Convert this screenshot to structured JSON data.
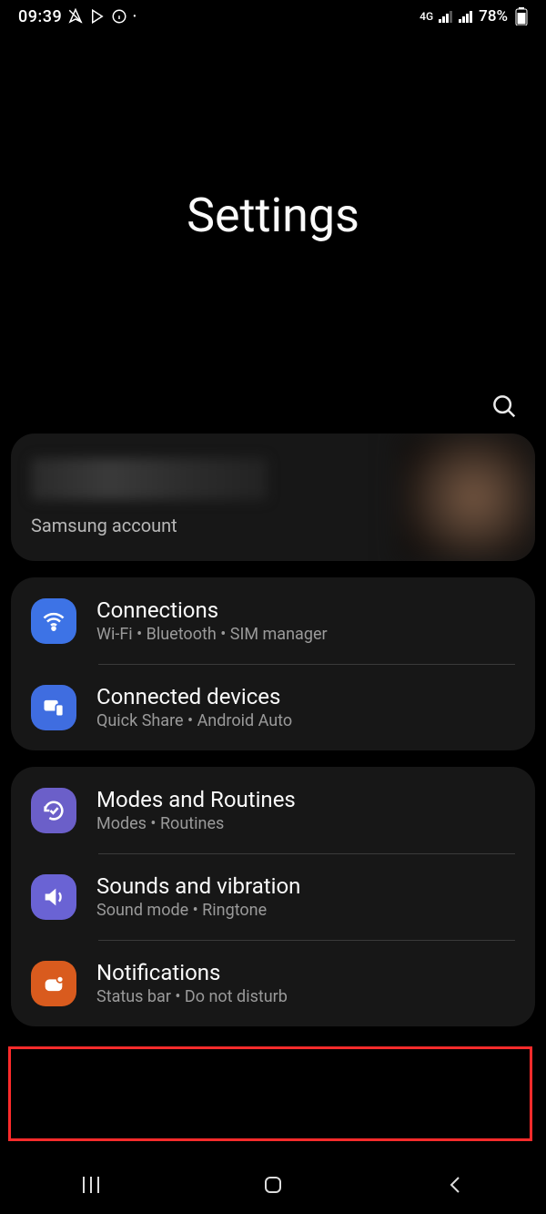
{
  "status_bar": {
    "time": "09:39",
    "network_label": "4G",
    "battery_text": "78%"
  },
  "header": {
    "title": "Settings"
  },
  "account": {
    "label": "Samsung account"
  },
  "groups": [
    {
      "rows": [
        {
          "title": "Connections",
          "subtitle": "Wi-Fi  •  Bluetooth  •  SIM manager"
        },
        {
          "title": "Connected devices",
          "subtitle": "Quick Share  •  Android Auto"
        }
      ]
    },
    {
      "rows": [
        {
          "title": "Modes and Routines",
          "subtitle": "Modes  •  Routines"
        },
        {
          "title": "Sounds and vibration",
          "subtitle": "Sound mode  •  Ringtone"
        },
        {
          "title": "Notifications",
          "subtitle": "Status bar  •  Do not disturb"
        }
      ]
    }
  ]
}
